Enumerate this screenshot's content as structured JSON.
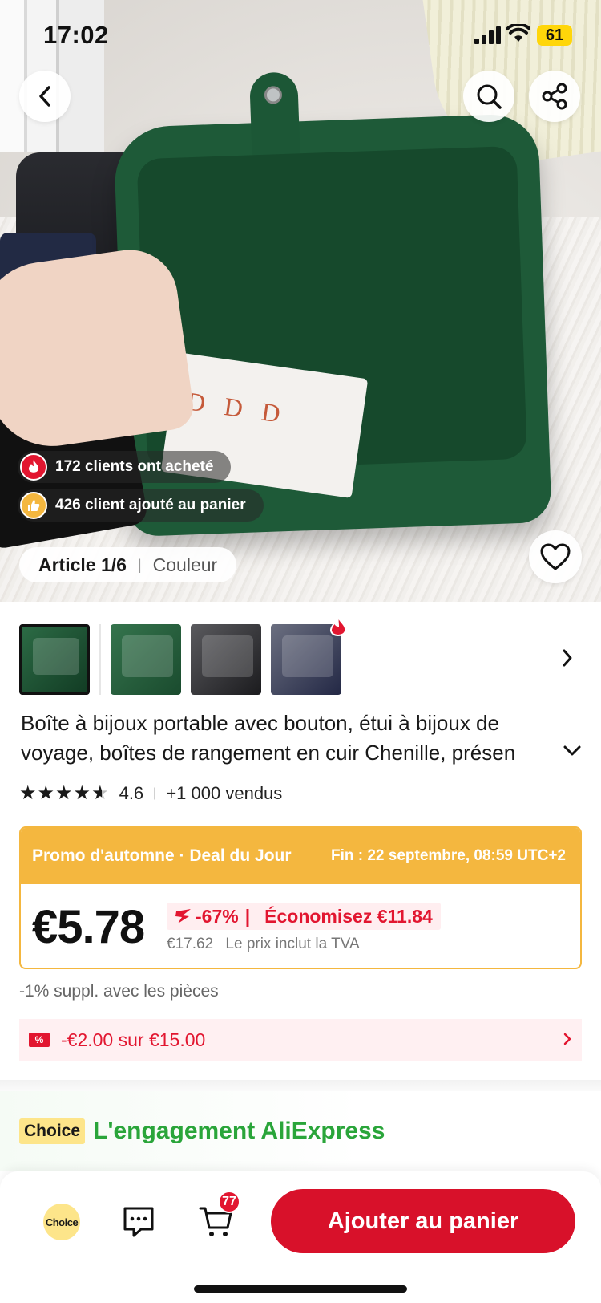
{
  "status_bar": {
    "time": "17:02",
    "battery": "61"
  },
  "hero": {
    "social_proof": [
      {
        "text": "172 clients ont acheté",
        "icon": "flame-icon",
        "color": "#e21630"
      },
      {
        "text": "426 client ajouté au panier",
        "icon": "thumbs-up-icon",
        "color": "#f4b73f"
      }
    ],
    "article_label": "Article 1/6",
    "article_option": "Couleur"
  },
  "product": {
    "title_line1": "Boîte à bijoux portable avec bouton, étui à bijoux de",
    "title_line2": "voyage, boîtes de rangement en cuir Chenille, présen",
    "rating": "4.6",
    "stars": 4.6,
    "sold": "+1 000 vendus"
  },
  "promo": {
    "label": "Promo d'automne · Deal du Jour",
    "ends": "Fin : 22 septembre, 08:59 UTC+2",
    "price": "€5.78",
    "discount": "-67%",
    "savings": "Économisez €11.84",
    "original_price": "€17.62",
    "tax_note": "Le prix inclut la TVA"
  },
  "coins_note": "-1% suppl. avec les pièces",
  "coupon": {
    "text": "-€2.00 sur €15.00",
    "icon_label": "%"
  },
  "choice": {
    "badge": "Choice",
    "text": "L'engagement AliExpress"
  },
  "bottom_bar": {
    "choice_label": "Choice",
    "cart_count": "77",
    "add_to_cart": "Ajouter au panier"
  },
  "colors": {
    "accent_red": "#e21630",
    "promo_orange": "#f4b73f",
    "choice_green": "#2aa53a"
  }
}
